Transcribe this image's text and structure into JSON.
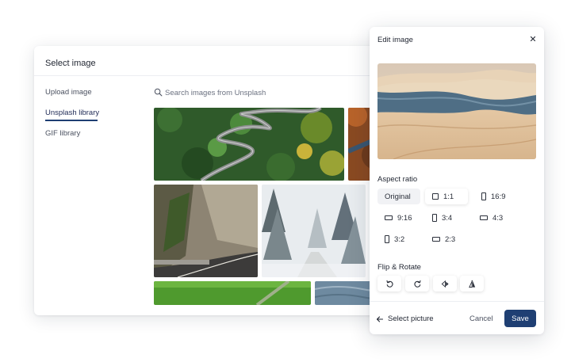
{
  "select_dialog": {
    "title": "Select image",
    "sidebar": {
      "items": [
        {
          "label": "Upload image"
        },
        {
          "label": "Unsplash library"
        },
        {
          "label": "GIF library"
        }
      ]
    },
    "search": {
      "placeholder": "Search images from Unsplash",
      "value": "",
      "icon": "search-icon"
    }
  },
  "edit_panel": {
    "title": "Edit image",
    "close_icon": "close-icon",
    "aspect_ratio": {
      "title": "Aspect ratio",
      "options": [
        {
          "label": "Original",
          "icon": ""
        },
        {
          "label": "1:1",
          "icon": "square-icon"
        },
        {
          "label": "16:9",
          "icon": "portrait-icon"
        },
        {
          "label": "9:16",
          "icon": "landscape-icon"
        },
        {
          "label": "3:4",
          "icon": "portrait-icon"
        },
        {
          "label": "4:3",
          "icon": "landscape-icon"
        },
        {
          "label": "3:2",
          "icon": "portrait-icon"
        },
        {
          "label": "2:3",
          "icon": "landscape-icon"
        }
      ]
    },
    "flip_rotate": {
      "title": "Flip & Rotate",
      "tools": [
        {
          "icon": "rotate-left-icon"
        },
        {
          "icon": "rotate-right-icon"
        },
        {
          "icon": "flip-horizontal-icon"
        },
        {
          "icon": "flip-vertical-icon"
        }
      ]
    },
    "footer": {
      "back_label": "Select picture",
      "cancel_label": "Cancel",
      "save_label": "Save"
    }
  },
  "colors": {
    "primary": "#1f3f73",
    "selected_bg": "#f1f2f5",
    "border": "#eceef2"
  }
}
